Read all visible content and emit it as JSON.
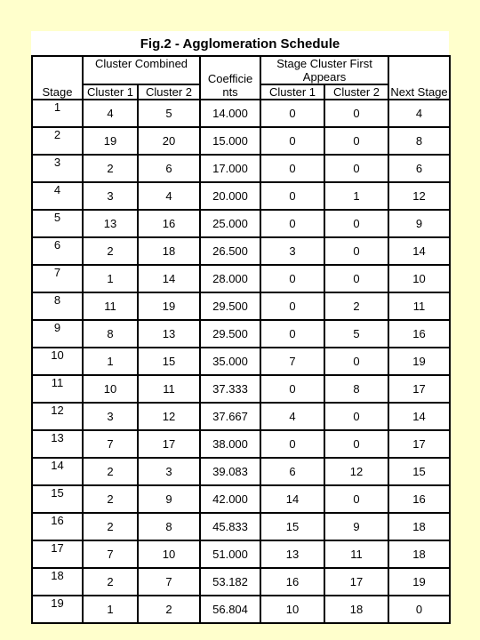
{
  "page": {
    "background_color": "#FFFFCC",
    "panel_color": "#FFFFFF",
    "border_color": "#000000"
  },
  "title": "Fig.2 - Agglomeration Schedule",
  "table": {
    "group_headers": {
      "stage": "Stage",
      "cluster_combined": "Cluster Combined",
      "coefficients": "Coefficie nts",
      "stage_cluster_first_appears": "Stage Cluster First Appears",
      "next_stage": "Next Stage"
    },
    "sub_headers": {
      "cc_cluster1": "Cluster 1",
      "cc_cluster2": "Cluster 2",
      "scfa_cluster1": "Cluster 1",
      "scfa_cluster2": "Cluster 2"
    },
    "columns": [
      "Stage",
      "Cluster 1",
      "Cluster 2",
      "Coefficients",
      "Cluster 1",
      "Cluster 2",
      "Next Stage"
    ],
    "rows": [
      {
        "stage": "1",
        "cc1": "4",
        "cc2": "5",
        "coef": "14.000",
        "scfa1": "0",
        "scfa2": "0",
        "next": "4"
      },
      {
        "stage": "2",
        "cc1": "19",
        "cc2": "20",
        "coef": "15.000",
        "scfa1": "0",
        "scfa2": "0",
        "next": "8"
      },
      {
        "stage": "3",
        "cc1": "2",
        "cc2": "6",
        "coef": "17.000",
        "scfa1": "0",
        "scfa2": "0",
        "next": "6"
      },
      {
        "stage": "4",
        "cc1": "3",
        "cc2": "4",
        "coef": "20.000",
        "scfa1": "0",
        "scfa2": "1",
        "next": "12"
      },
      {
        "stage": "5",
        "cc1": "13",
        "cc2": "16",
        "coef": "25.000",
        "scfa1": "0",
        "scfa2": "0",
        "next": "9"
      },
      {
        "stage": "6",
        "cc1": "2",
        "cc2": "18",
        "coef": "26.500",
        "scfa1": "3",
        "scfa2": "0",
        "next": "14"
      },
      {
        "stage": "7",
        "cc1": "1",
        "cc2": "14",
        "coef": "28.000",
        "scfa1": "0",
        "scfa2": "0",
        "next": "10"
      },
      {
        "stage": "8",
        "cc1": "11",
        "cc2": "19",
        "coef": "29.500",
        "scfa1": "0",
        "scfa2": "2",
        "next": "11"
      },
      {
        "stage": "9",
        "cc1": "8",
        "cc2": "13",
        "coef": "29.500",
        "scfa1": "0",
        "scfa2": "5",
        "next": "16"
      },
      {
        "stage": "10",
        "cc1": "1",
        "cc2": "15",
        "coef": "35.000",
        "scfa1": "7",
        "scfa2": "0",
        "next": "19"
      },
      {
        "stage": "11",
        "cc1": "10",
        "cc2": "11",
        "coef": "37.333",
        "scfa1": "0",
        "scfa2": "8",
        "next": "17"
      },
      {
        "stage": "12",
        "cc1": "3",
        "cc2": "12",
        "coef": "37.667",
        "scfa1": "4",
        "scfa2": "0",
        "next": "14"
      },
      {
        "stage": "13",
        "cc1": "7",
        "cc2": "17",
        "coef": "38.000",
        "scfa1": "0",
        "scfa2": "0",
        "next": "17"
      },
      {
        "stage": "14",
        "cc1": "2",
        "cc2": "3",
        "coef": "39.083",
        "scfa1": "6",
        "scfa2": "12",
        "next": "15"
      },
      {
        "stage": "15",
        "cc1": "2",
        "cc2": "9",
        "coef": "42.000",
        "scfa1": "14",
        "scfa2": "0",
        "next": "16"
      },
      {
        "stage": "16",
        "cc1": "2",
        "cc2": "8",
        "coef": "45.833",
        "scfa1": "15",
        "scfa2": "9",
        "next": "18"
      },
      {
        "stage": "17",
        "cc1": "7",
        "cc2": "10",
        "coef": "51.000",
        "scfa1": "13",
        "scfa2": "11",
        "next": "18"
      },
      {
        "stage": "18",
        "cc1": "2",
        "cc2": "7",
        "coef": "53.182",
        "scfa1": "16",
        "scfa2": "17",
        "next": "19"
      },
      {
        "stage": "19",
        "cc1": "1",
        "cc2": "2",
        "coef": "56.804",
        "scfa1": "10",
        "scfa2": "18",
        "next": "0"
      }
    ]
  }
}
